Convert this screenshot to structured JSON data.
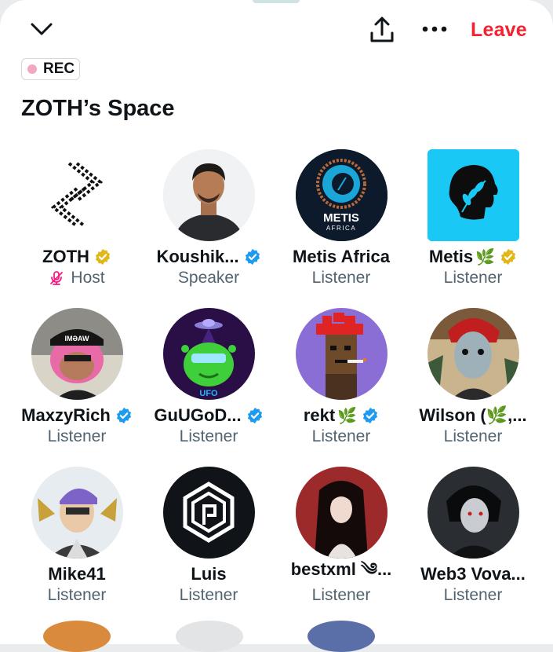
{
  "header": {
    "leave_label": "Leave",
    "rec_label": "REC",
    "space_title": "ZOTH’s Space"
  },
  "icons": {
    "collapse": "chevron-down-icon",
    "share": "share-icon",
    "more": "more-horizontal-icon"
  },
  "colors": {
    "leave": "#f4212e",
    "verified_blue": "#1d9bf0",
    "verified_gold": "#e2b719",
    "secondary_text": "#536471",
    "rec_dot": "#f2a7c3"
  },
  "participants": [
    {
      "name": "ZOTH",
      "badge": "gold",
      "leaf": "",
      "role": "Host"
    },
    {
      "name": "Koushik...",
      "badge": "blue",
      "leaf": "",
      "role": "Speaker"
    },
    {
      "name": "Metis Africa",
      "badge": "",
      "leaf": "",
      "role": "Listener"
    },
    {
      "name": "Metis",
      "badge": "gold",
      "leaf": "🌿",
      "role": "Listener"
    },
    {
      "name": "MaxzyRich",
      "badge": "blue",
      "leaf": "",
      "role": "Listener"
    },
    {
      "name": "GuUGoD...",
      "badge": "blue",
      "leaf": "",
      "role": "Listener"
    },
    {
      "name": "rekt",
      "badge": "blue",
      "leaf": "🌿",
      "role": "Listener"
    },
    {
      "name": "Wilson (🌿,...",
      "badge": "",
      "leaf": "",
      "role": "Listener"
    },
    {
      "name": "Mike41",
      "badge": "",
      "leaf": "",
      "role": "Listener"
    },
    {
      "name": "Luis",
      "badge": "",
      "leaf": "",
      "role": "Listener"
    },
    {
      "name": "bestxml ༄...",
      "badge": "",
      "leaf": "",
      "role": "Listener"
    },
    {
      "name": "Web3 Vova...",
      "badge": "",
      "leaf": "",
      "role": "Listener"
    }
  ],
  "avatar_text": {
    "metis_africa_line1": "METIS",
    "metis_africa_line2": "AFRICA",
    "maxzy_cap": "IMƏAW",
    "gugod_tag": "UFO"
  }
}
